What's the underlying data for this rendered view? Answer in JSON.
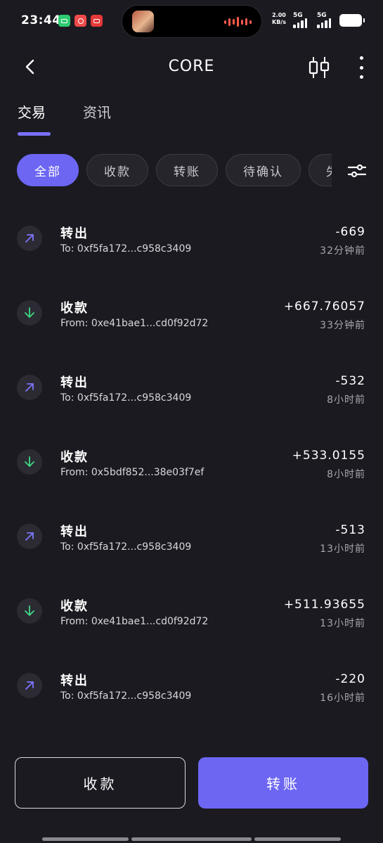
{
  "status_bar": {
    "time": "23:44",
    "speed_value": "2.00",
    "speed_unit": "KB/s",
    "net1": "5G",
    "net2": "5G"
  },
  "header": {
    "title": "CORE"
  },
  "tabs": [
    {
      "label": "交易",
      "active": true
    },
    {
      "label": "资讯",
      "active": false
    }
  ],
  "filters": [
    {
      "label": "全部",
      "active": true
    },
    {
      "label": "收款",
      "active": false
    },
    {
      "label": "转账",
      "active": false
    },
    {
      "label": "待确认",
      "active": false
    },
    {
      "label": "失",
      "active": false
    }
  ],
  "transactions": [
    {
      "direction": "out",
      "type": "转出",
      "address": "To: 0xf5fa172...c958c3409",
      "amount": "-669",
      "time": "32分钟前"
    },
    {
      "direction": "in",
      "type": "收款",
      "address": "From: 0xe41bae1...cd0f92d72",
      "amount": "+667.76057",
      "time": "33分钟前"
    },
    {
      "direction": "out",
      "type": "转出",
      "address": "To: 0xf5fa172...c958c3409",
      "amount": "-532",
      "time": "8小时前"
    },
    {
      "direction": "in",
      "type": "收款",
      "address": "From: 0x5bdf852...38e03f7ef",
      "amount": "+533.0155",
      "time": "8小时前"
    },
    {
      "direction": "out",
      "type": "转出",
      "address": "To: 0xf5fa172...c958c3409",
      "amount": "-513",
      "time": "13小时前"
    },
    {
      "direction": "in",
      "type": "收款",
      "address": "From: 0xe41bae1...cd0f92d72",
      "amount": "+511.93655",
      "time": "13小时前"
    },
    {
      "direction": "out",
      "type": "转出",
      "address": "To: 0xf5fa172...c958c3409",
      "amount": "-220",
      "time": "16小时前"
    }
  ],
  "actions": {
    "receive_label": "收款",
    "transfer_label": "转账"
  },
  "colors": {
    "background": "#1b1a20",
    "accent": "#6c66f3",
    "out_arrow": "#7d76ff",
    "in_arrow": "#3ddc84"
  },
  "icons": {
    "back": "chevron-left-icon",
    "chart": "candlestick-chart-icon",
    "more": "more-vertical-icon",
    "filter": "filter-sliders-icon",
    "out": "arrow-up-right-icon",
    "in": "arrow-down-icon"
  }
}
